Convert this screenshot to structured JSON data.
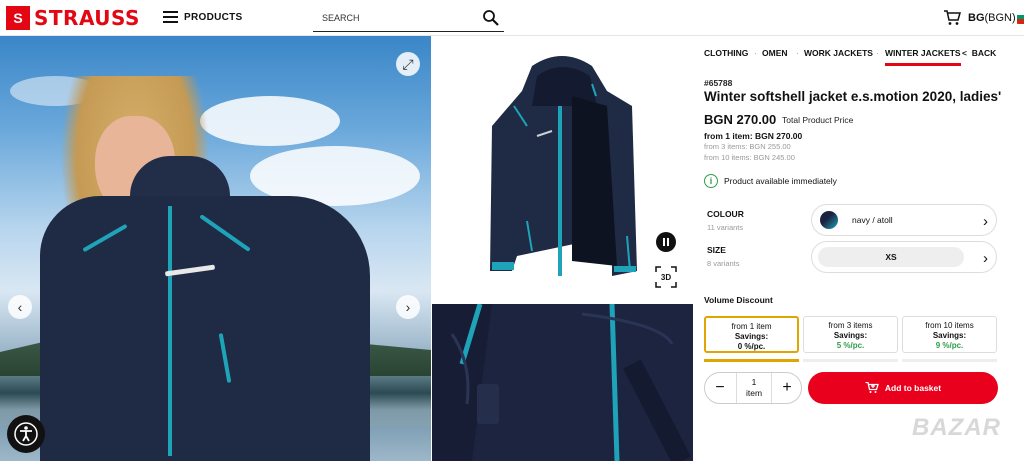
{
  "header": {
    "logo_text": "STRAUSS",
    "logo_mark": "S",
    "menu_label": "PRODUCTS",
    "search_placeholder": "SEARCH",
    "currency_code": "BG",
    "currency_unit": "(BGN)",
    "icons": [
      "hamburger-icon",
      "search-icon",
      "cart-icon",
      "flag-icon"
    ]
  },
  "gallery": {
    "btn_3d": "3D",
    "prev_label": "‹",
    "next_label": "›",
    "expand_label": "⤢",
    "icons": [
      "expand-icon",
      "chevron-left-icon",
      "chevron-right-icon",
      "pause-icon",
      "3d-view-icon",
      "accessibility-icon"
    ]
  },
  "breadcrumb": {
    "items": [
      "CLOTHING",
      "·",
      "OMEN",
      "·",
      "WORK JACKETS",
      "·",
      "WINTER JACKETS"
    ],
    "back_label": "BACK",
    "back_arrow": "<"
  },
  "product": {
    "sku": "#65788",
    "title": "Winter softshell jacket e.s.motion 2020, ladies'",
    "price": "BGN 270.00",
    "price_label": "Total Product Price",
    "tier1": "from 1 item: BGN 270.00",
    "tier2": "from 3 items: BGN 255.00",
    "tier3": "from 10 items: BGN 245.00",
    "availability_icon": "i",
    "availability": "Product available immediately"
  },
  "options": {
    "colour_label": "COLOUR",
    "colour_variants": "11 variants",
    "colour_value": "navy / atoll",
    "size_label": "SIZE",
    "size_variants": "8 variants",
    "size_value": "XS",
    "chevron": "›"
  },
  "volume": {
    "title": "Volume Discount",
    "tiers": [
      {
        "label": "from 1 item",
        "savings": "Savings:",
        "pct": "0 %/pc.",
        "selected": true
      },
      {
        "label": "from 3 items",
        "savings": "Savings:",
        "pct": "5 %/pc.",
        "selected": false
      },
      {
        "label": "from 10 items",
        "savings": "Savings:",
        "pct": "9 %/pc.",
        "selected": false
      }
    ]
  },
  "basket": {
    "minus": "−",
    "plus": "+",
    "qty": "1",
    "qty_unit": "item",
    "add_label": "Add to basket"
  },
  "colors": {
    "brand_red": "#e30613",
    "button_red": "#e8001c",
    "selected_tier": "#e0a500",
    "savings_green": "#2e9e4a",
    "jacket_navy": "#1f2a44",
    "jacket_accent": "#1fa3b8"
  },
  "watermark": "BAZAR"
}
